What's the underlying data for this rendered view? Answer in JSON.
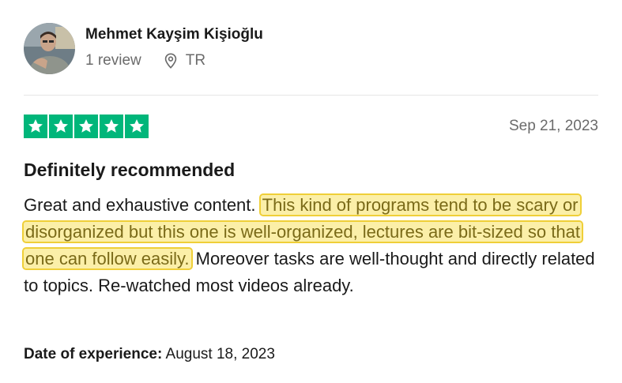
{
  "reviewer": {
    "name": "Mehmet Kayşim Kişioğlu",
    "review_count": "1 review",
    "country": "TR"
  },
  "review": {
    "rating": 5,
    "rating_color": "#00b67a",
    "date": "Sep 21, 2023",
    "title": "Definitely recommended",
    "text_before": "Great and exhaustive content.",
    "text_highlighted": "This kind of programs tend to be scary or disorganized but this one is well-organized, lectures are bit-sized so that one can follow easily.",
    "text_after": "Moreover tasks are well-thought and directly related to topics. Re-watched most videos already.",
    "highlight_color": "#fbefa8",
    "experience_label": "Date of experience:",
    "experience_date": "August 18, 2023"
  },
  "icons": {
    "location": "map-pin-icon",
    "star": "star-icon"
  }
}
